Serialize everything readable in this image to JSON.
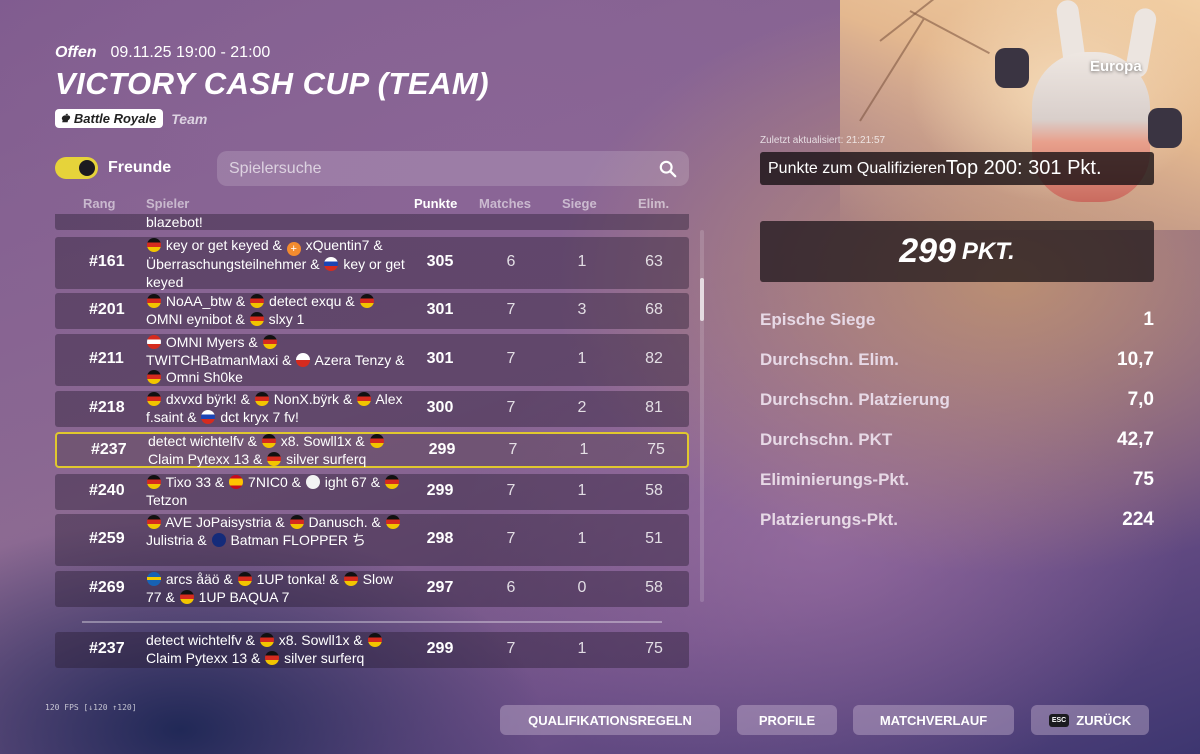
{
  "event": {
    "status": "Offen",
    "datetime": "09.11.25 19:00 - 21:00",
    "title": "VICTORY CASH CUP (TEAM)",
    "mode": "Battle Royale",
    "team_label": "Team",
    "region": "Europa"
  },
  "filters": {
    "friends_label": "Freunde",
    "friends_toggle_on": true,
    "search_placeholder": "Spielersuche"
  },
  "table": {
    "headers": {
      "rank": "Rang",
      "players": "Spieler",
      "points": "Punkte",
      "matches": "Matches",
      "wins": "Siege",
      "elims": "Elim."
    },
    "partial_top_text": "blazebot!",
    "rows": [
      {
        "rank": "#161",
        "players": [
          "key or get keyed &",
          "xQuentin7",
          "& Überraschungsteilnehmer &",
          "key or get keyed"
        ],
        "points": "305",
        "matches": "6",
        "wins": "1",
        "elims": "63"
      },
      {
        "rank": "#201",
        "players": [
          "NoAA_btw &",
          "detect exqu &",
          "OMNI eynibot &",
          "slxy 1"
        ],
        "points": "301",
        "matches": "7",
        "wins": "3",
        "elims": "68"
      },
      {
        "rank": "#211",
        "players": [
          "OMNI Myers &",
          "TWITCHBatmanMaxi &",
          "Azera",
          "Tenzy &",
          "Omni Sh0ke"
        ],
        "points": "301",
        "matches": "7",
        "wins": "1",
        "elims": "82"
      },
      {
        "rank": "#218",
        "players": [
          "dxvxd bÿrk! &",
          "NonX.bÿrk &",
          "Alex f.saint &",
          "dct kryx 7 fv!"
        ],
        "points": "300",
        "matches": "7",
        "wins": "2",
        "elims": "81"
      },
      {
        "rank": "#237",
        "players": [
          "detect wichtelfv &",
          "x8. Sowll1x &",
          "Claim Pytexx 13 &",
          "silver surferq"
        ],
        "points": "299",
        "matches": "7",
        "wins": "1",
        "elims": "75",
        "highlight": true
      },
      {
        "rank": "#240",
        "players": [
          "Tixo 33 &",
          "7NIC0 &",
          "ight 67",
          "&",
          "Tetzon"
        ],
        "points": "299",
        "matches": "7",
        "wins": "1",
        "elims": "58"
      },
      {
        "rank": "#259",
        "players": [
          "AVE JoPaisystria &",
          "Danusch.",
          "&",
          "Julistria &",
          "Batman FLOPPER",
          "ち"
        ],
        "points": "298",
        "matches": "7",
        "wins": "1",
        "elims": "51"
      },
      {
        "rank": "#269",
        "players": [
          "arcs åäö &",
          "1UP tonka! &",
          "Slow 77 &",
          "1UP BAQUA 7"
        ],
        "points": "297",
        "matches": "6",
        "wins": "0",
        "elims": "58"
      }
    ],
    "own_row": {
      "rank": "#237",
      "players": [
        "detect wichtelfv &",
        "x8. Sowll1x &",
        "Claim Pytexx 13 &",
        "silver surferq"
      ],
      "points": "299",
      "matches": "7",
      "wins": "1",
      "elims": "75"
    }
  },
  "qualification": {
    "last_updated": "Zuletzt aktualisiert: 21:21:57",
    "label": "Punkte zum Qualifizieren",
    "value": "Top 200: 301 Pkt."
  },
  "score": {
    "value": "299",
    "unit": "PKT."
  },
  "stats": [
    {
      "label": "Epische Siege",
      "value": "1"
    },
    {
      "label": "Durchschn. Elim.",
      "value": "10,7"
    },
    {
      "label": "Durchschn. Platzierung",
      "value": "7,0"
    },
    {
      "label": "Durchschn. PKT",
      "value": "42,7"
    },
    {
      "label": "Eliminierungs-Pkt.",
      "value": "75"
    },
    {
      "label": "Platzierungs-Pkt.",
      "value": "224"
    }
  ],
  "footer": {
    "fps": "120 FPS [↓120 ↑120]",
    "buttons": {
      "rules": "QUALIFIKATIONSREGELN",
      "profiles": "PROFILE",
      "history": "MATCHVERLAUF",
      "back_key": "ESC",
      "back": "ZURÜCK"
    }
  },
  "colors": {
    "highlight_border": "#e0c82e",
    "toggle_on": "#e6d33a"
  },
  "icons": [
    "crown-icon",
    "search-icon",
    "flag-icon"
  ]
}
